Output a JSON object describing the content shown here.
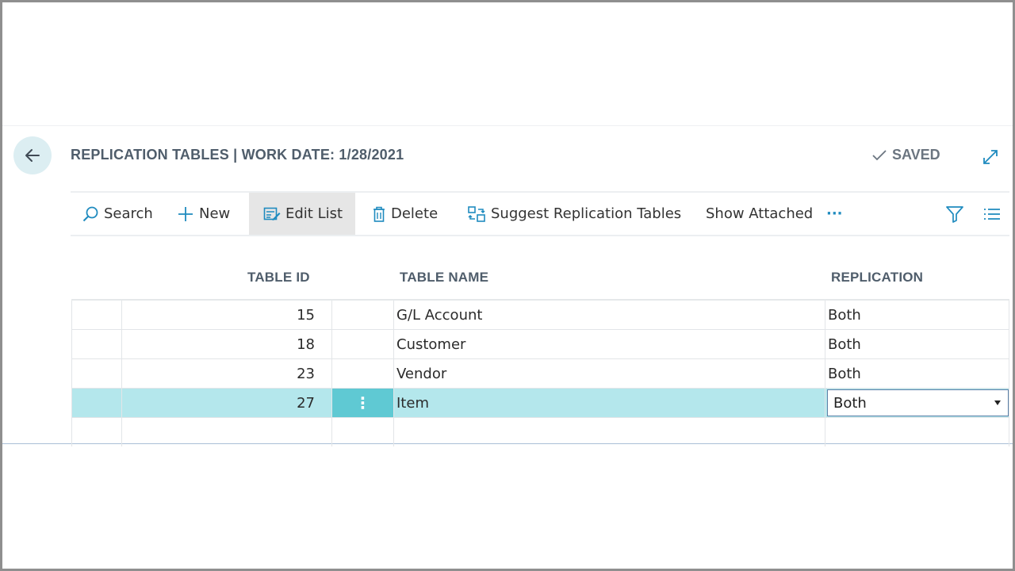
{
  "header": {
    "title": "REPLICATION TABLES | WORK DATE: 1/28/2021",
    "saved_label": "SAVED"
  },
  "actions": {
    "search": "Search",
    "new": "New",
    "edit_list": "Edit List",
    "delete": "Delete",
    "suggest": "Suggest Replication Tables",
    "show_attached": "Show Attached",
    "more": "···"
  },
  "columns": {
    "table_id": "TABLE ID",
    "table_name": "TABLE NAME",
    "replication": "REPLICATION"
  },
  "rows": [
    {
      "table_id": "15",
      "table_name": "G/L Account",
      "replication": "Both"
    },
    {
      "table_id": "18",
      "table_name": "Customer",
      "replication": "Both"
    },
    {
      "table_id": "23",
      "table_name": "Vendor",
      "replication": "Both"
    },
    {
      "table_id": "27",
      "table_name": "Item",
      "replication": "Both",
      "selected": true
    },
    {
      "table_id": "",
      "table_name": "",
      "replication": ""
    }
  ],
  "colors": {
    "accent": "#5fc9d3",
    "selected_row": "#b4e7ec",
    "title_text": "#4f5d6b",
    "icon_blue": "#1f8bbf"
  },
  "icons": [
    "back-arrow-icon",
    "checkmark-icon",
    "expand-icon",
    "search-icon",
    "plus-icon",
    "edit-list-icon",
    "delete-icon",
    "suggest-icon",
    "more-icon",
    "filter-icon",
    "list-view-icon",
    "row-menu-icon",
    "dropdown-caret-icon"
  ]
}
